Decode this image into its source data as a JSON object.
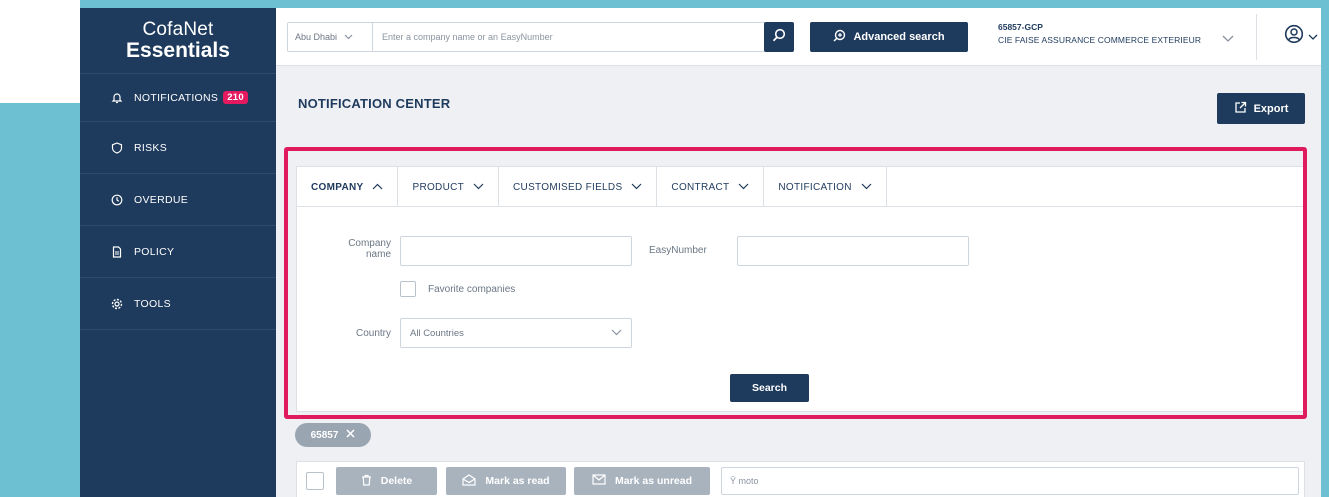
{
  "brand": {
    "line1": "CofaNet",
    "line2": "Essentials"
  },
  "sidebar": {
    "items": [
      {
        "label": "NOTIFICATIONS",
        "badge": "210",
        "icon": "bell-icon"
      },
      {
        "label": "RISKS",
        "icon": "shield-icon"
      },
      {
        "label": "OVERDUE",
        "icon": "clock-icon"
      },
      {
        "label": "POLICY",
        "icon": "document-icon"
      },
      {
        "label": "TOOLS",
        "icon": "gear-icon"
      }
    ]
  },
  "topbar": {
    "location": "Abu Dhabi",
    "search_placeholder": "Enter a company name or an EasyNumber",
    "advanced_search": "Advanced search",
    "account_code": "65857-GCP",
    "account_name": "CIE FAISE ASSURANCE COMMERCE EXTERIEUR"
  },
  "page": {
    "title": "NOTIFICATION CENTER",
    "export": "Export"
  },
  "filters": {
    "tabs": [
      "COMPANY",
      "PRODUCT",
      "CUSTOMISED FIELDS",
      "CONTRACT",
      "NOTIFICATION"
    ],
    "company_name_label_1": "Company",
    "company_name_label_2": "name",
    "easynumber_label": "EasyNumber",
    "favorite_label": "Favorite companies",
    "country_label": "Country",
    "country_value": "All Countries",
    "search_button": "Search"
  },
  "chip": {
    "label": "65857"
  },
  "toolbar": {
    "delete": "Delete",
    "mark_read": "Mark as read",
    "mark_unread": "Mark as unread",
    "filter_value": "Ÿ moto"
  },
  "colors": {
    "navy": "#1e3a5c",
    "accent": "#e5195f",
    "highlight": "#e01b5d",
    "frame": "#6cc0d2"
  }
}
